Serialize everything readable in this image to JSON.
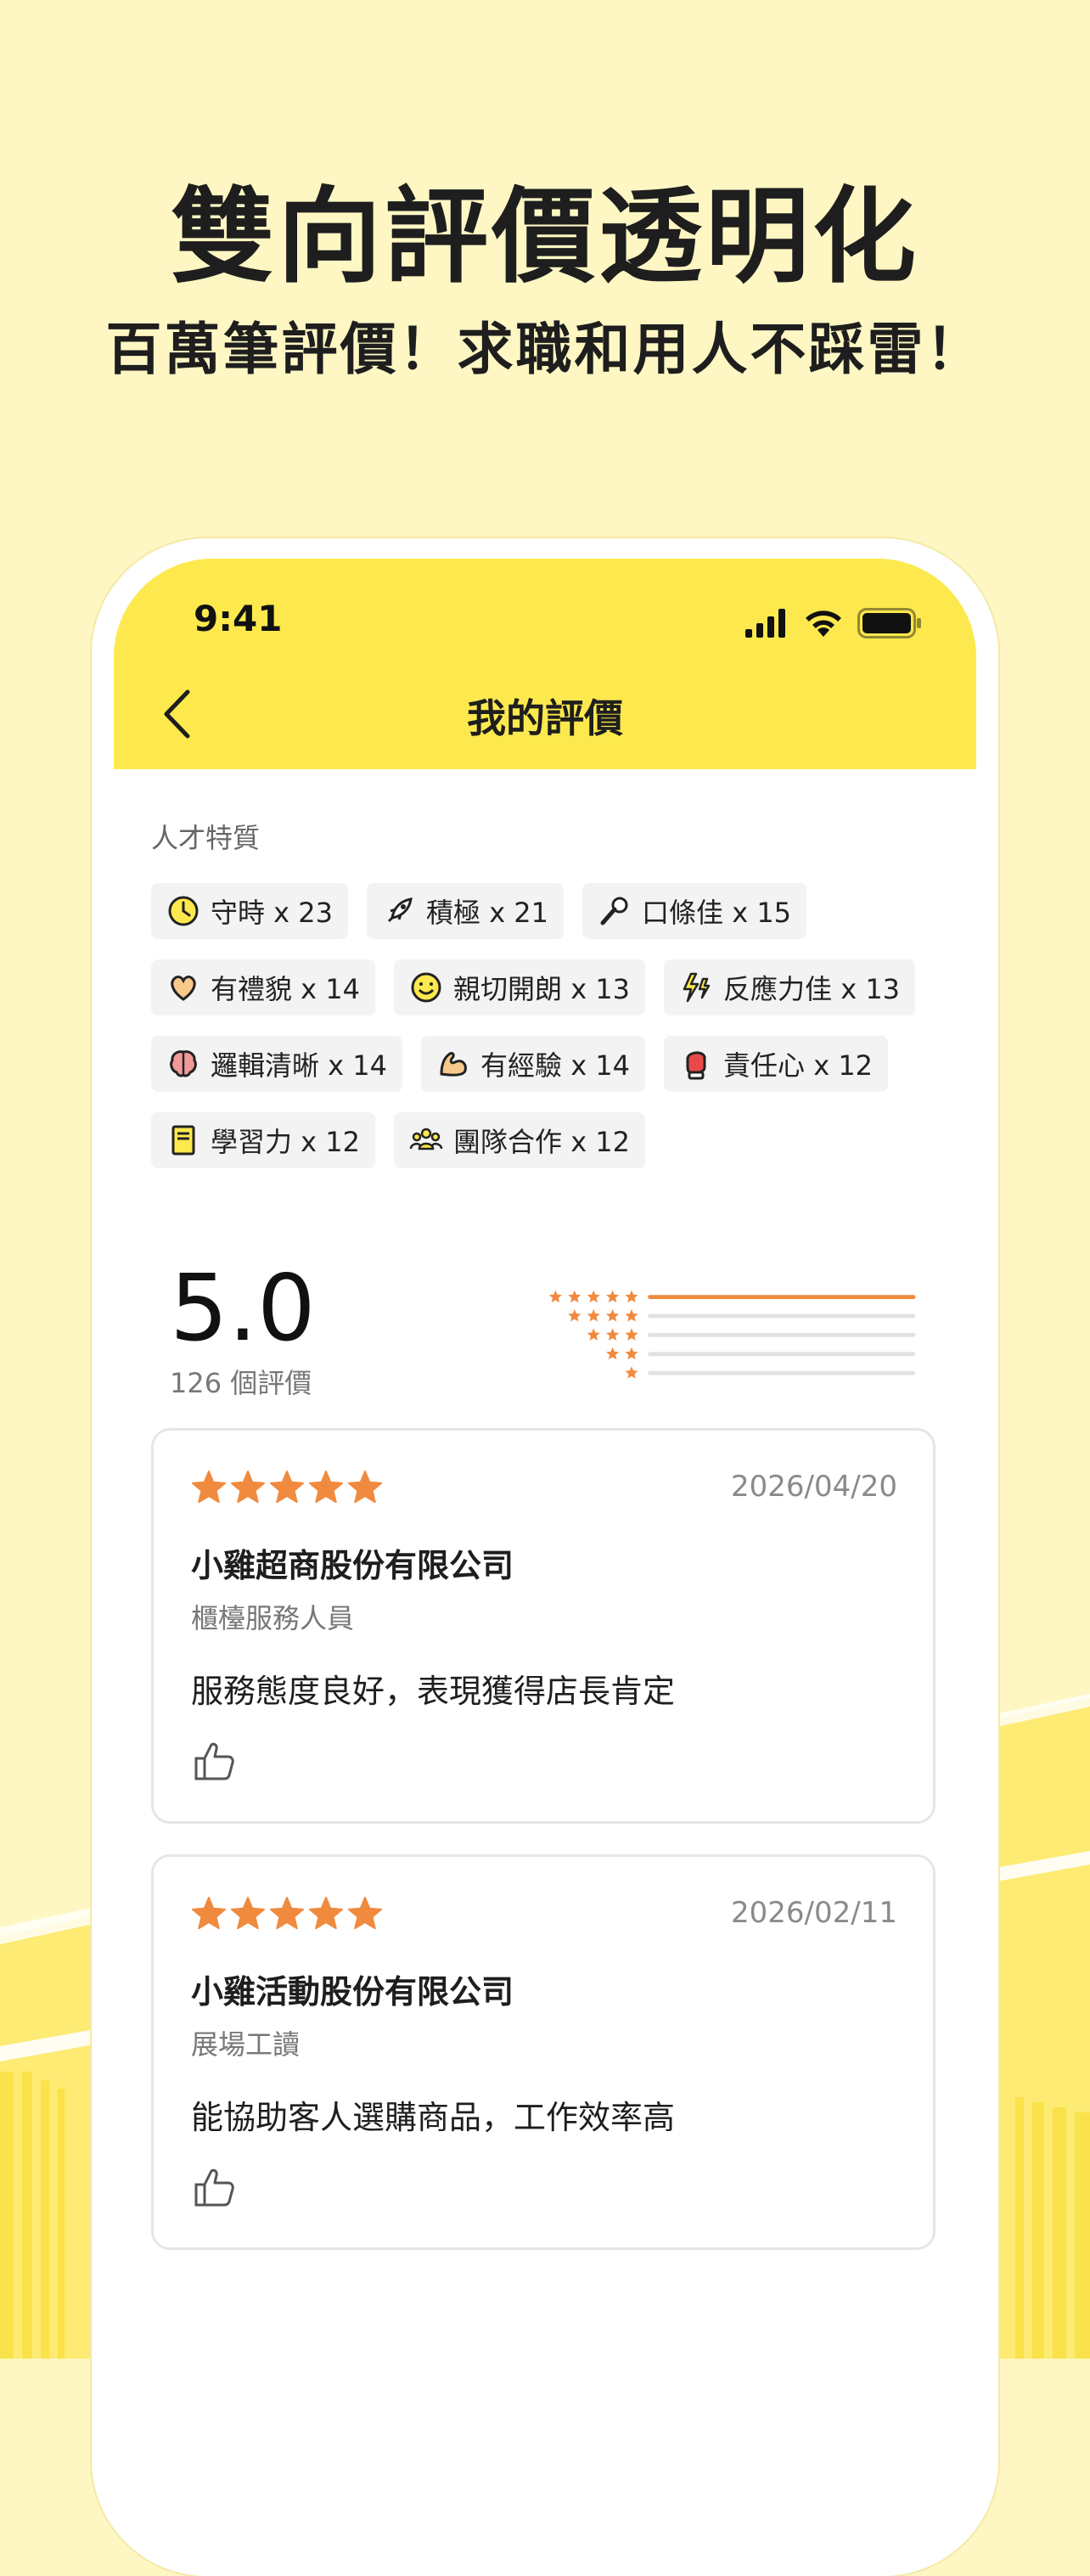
{
  "promo": {
    "headline": "雙向評價透明化",
    "subheadline": "百萬筆評價！求職和用人不踩雷！"
  },
  "status_bar": {
    "time": "9:41",
    "icons": [
      "signal-icon",
      "wifi-icon",
      "battery-icon"
    ]
  },
  "nav": {
    "back_icon": "chevron-left-icon",
    "title": "我的評價"
  },
  "traits": {
    "label": "人才特質",
    "rows": [
      [
        {
          "icon": "clock-icon",
          "label": "守時 x 23"
        },
        {
          "icon": "rocket-icon",
          "label": "積極 x 21"
        },
        {
          "icon": "microphone-icon",
          "label": "口條佳 x 15"
        }
      ],
      [
        {
          "icon": "heart-hands-icon",
          "label": "有禮貌 x 14"
        },
        {
          "icon": "smile-face-icon",
          "label": "親切開朗 x 13"
        },
        {
          "icon": "lightning-icon",
          "label": "反應力佳 x 13"
        }
      ],
      [
        {
          "icon": "brain-icon",
          "label": "邏輯清晰 x 14"
        },
        {
          "icon": "flexed-arm-icon",
          "label": "有經驗 x 14"
        },
        {
          "icon": "boxing-glove-icon",
          "label": "責任心 x 12"
        }
      ],
      [
        {
          "icon": "book-icon",
          "label": "學習力 x 12"
        },
        {
          "icon": "team-icon",
          "label": "團隊合作 x 12"
        }
      ]
    ]
  },
  "summary": {
    "score": "5.0",
    "count_label": "126 個評價",
    "distribution": [
      {
        "stars": 5,
        "fraction": 1.0
      },
      {
        "stars": 4,
        "fraction": 0.0
      },
      {
        "stars": 3,
        "fraction": 0.0
      },
      {
        "stars": 2,
        "fraction": 0.0
      },
      {
        "stars": 1,
        "fraction": 0.0
      }
    ]
  },
  "reviews": [
    {
      "rating": 5,
      "date": "2026/04/20",
      "company": "小雞超商股份有限公司",
      "role": "櫃檯服務人員",
      "comment": "服務態度良好，表現獲得店長肯定",
      "like_icon": "thumbs-up-icon"
    },
    {
      "rating": 5,
      "date": "2026/02/11",
      "company": "小雞活動股份有限公司",
      "role": "展場工讀",
      "comment": "能協助客人選購商品，工作效率高",
      "like_icon": "thumbs-up-icon"
    }
  ],
  "colors": {
    "background": "#FEF7C3",
    "accent_yellow": "#FDE94D",
    "star_orange": "#F08A3E",
    "text_dark": "#1E1E1E"
  }
}
